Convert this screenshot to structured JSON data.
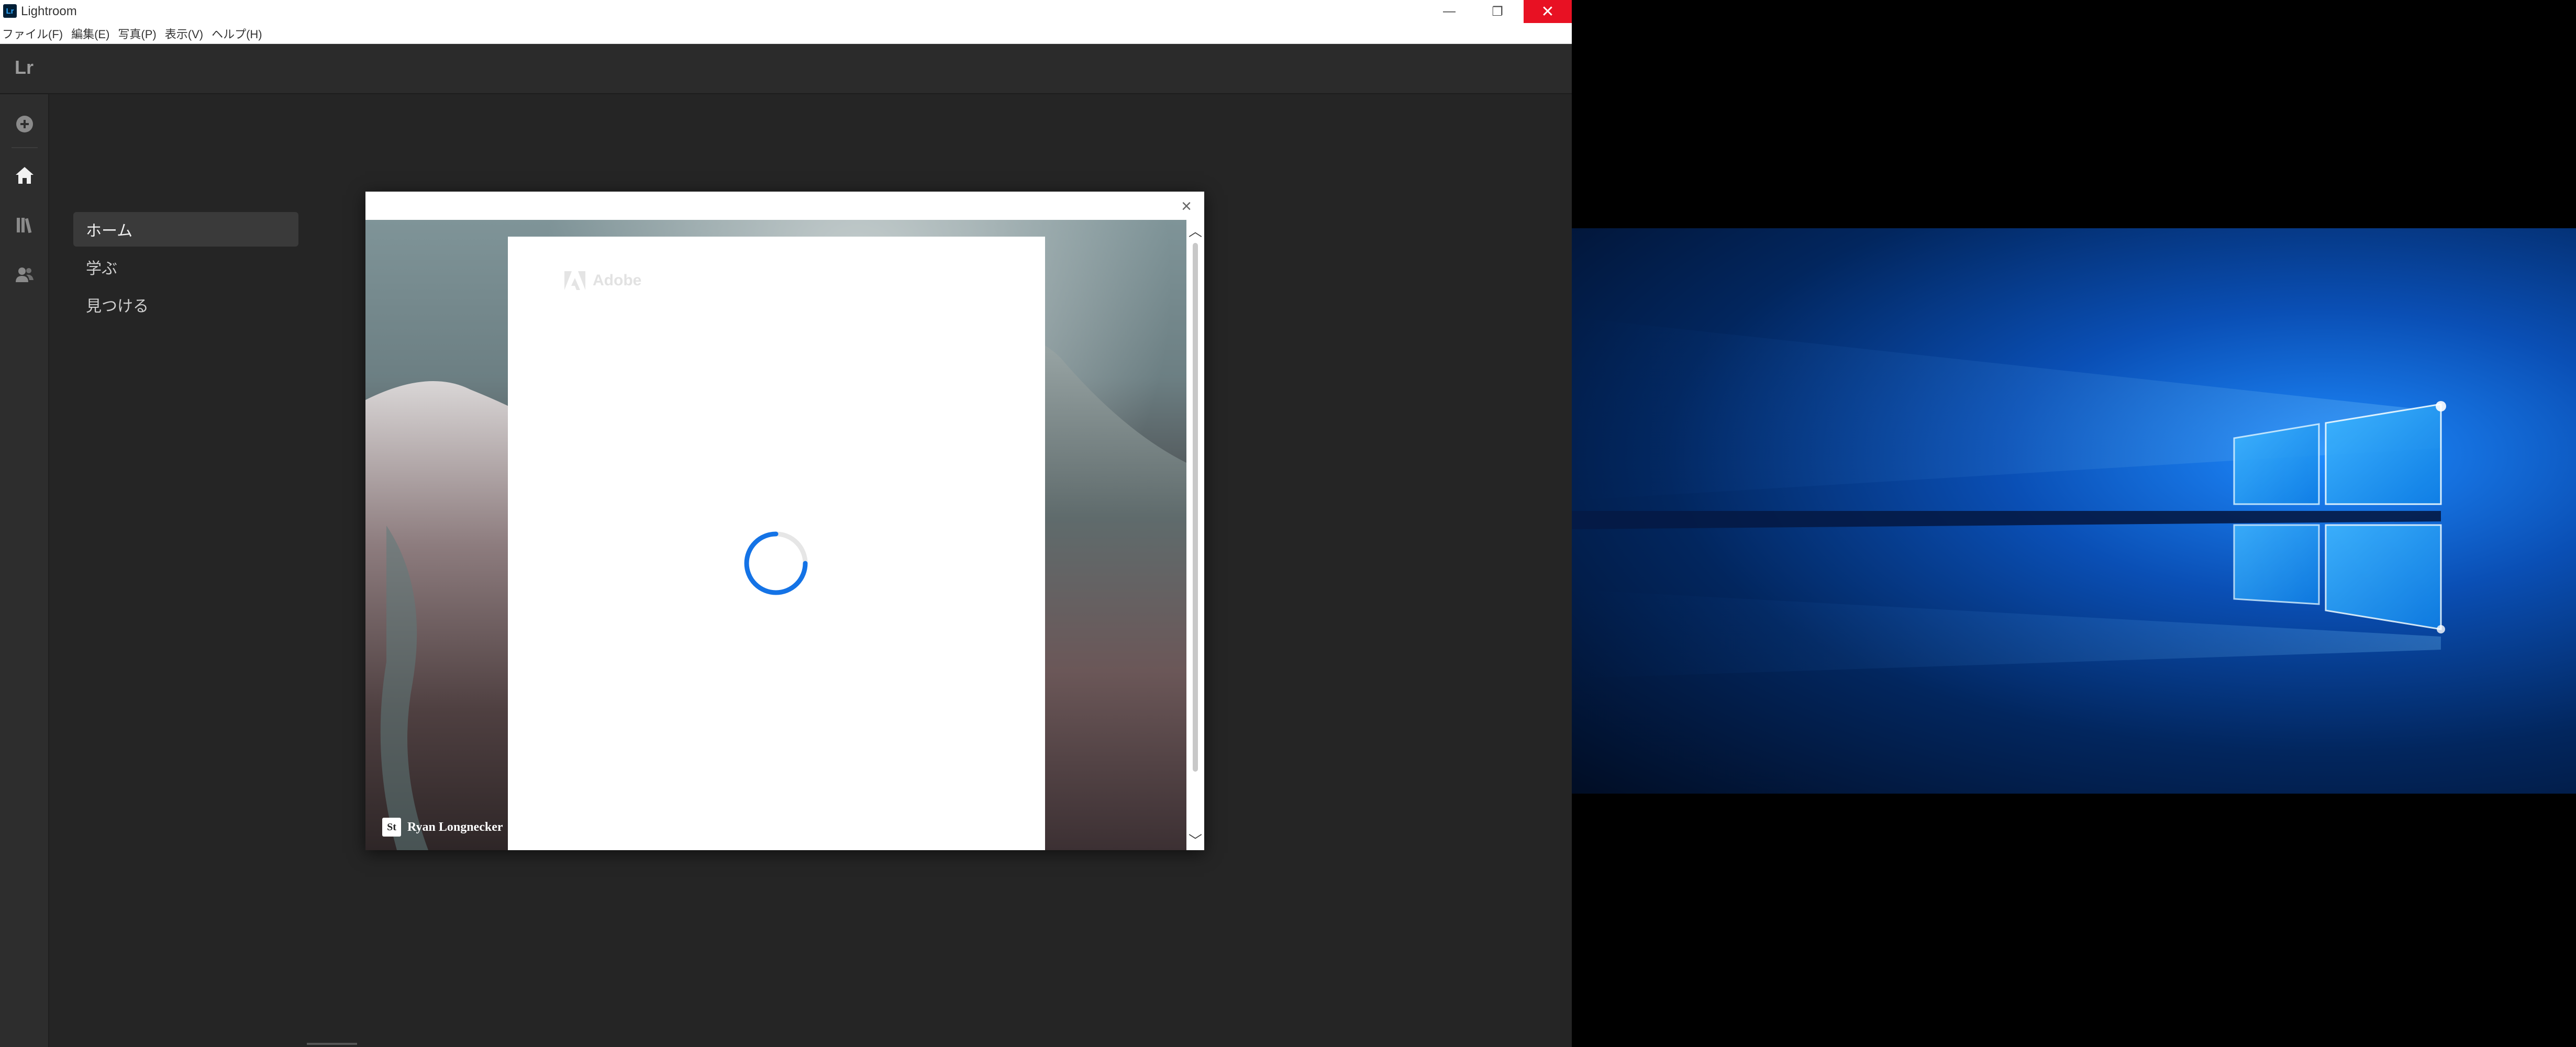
{
  "window": {
    "title": "Lightroom",
    "logo_text": "Lr",
    "minimize_glyph": "—",
    "maximize_glyph": "❐",
    "close_glyph": "✕"
  },
  "menubar": {
    "items": [
      "ファイル(F)",
      "編集(E)",
      "写真(P)",
      "表示(V)",
      "ヘルプ(H)"
    ]
  },
  "header": {
    "brand": "Lr"
  },
  "rail": {
    "icons": [
      "add-photos-icon",
      "home-icon",
      "library-icon",
      "people-icon"
    ]
  },
  "nav": {
    "items": [
      {
        "label": "ホーム",
        "active": true
      },
      {
        "label": "学ぶ",
        "active": false
      },
      {
        "label": "見つける",
        "active": false
      }
    ]
  },
  "dialog": {
    "close_glyph": "×",
    "adobe_label": "Adobe",
    "credit_badge": "St",
    "credit_name": "Ryan Longnecker",
    "loading": true
  },
  "colors": {
    "accent": "#1473e6",
    "close_red": "#e81123",
    "app_bg": "#252525"
  }
}
